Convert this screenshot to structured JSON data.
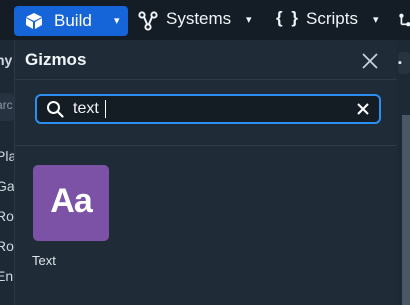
{
  "toolbar": {
    "build_label": "Build",
    "systems_label": "Systems",
    "scripts_label": "Scripts",
    "chevron": "▾",
    "build_icon": "cube-icon",
    "systems_icon": "network-icon",
    "scripts_icon": "braces-icon",
    "accent_color": "#1565d8"
  },
  "background_fragments": {
    "left": [
      "hy",
      "arc",
      "Pla",
      "Gar",
      "Roo",
      "Roo",
      "En"
    ]
  },
  "panel": {
    "title": "Gizmos",
    "close_icon": "close-icon",
    "search": {
      "value": "text",
      "placeholder": "",
      "search_icon": "search-icon",
      "clear_icon": "clear-icon"
    },
    "results": [
      {
        "label": "Text",
        "glyph": "Aa",
        "tile_color": "#7c52a7"
      }
    ]
  }
}
